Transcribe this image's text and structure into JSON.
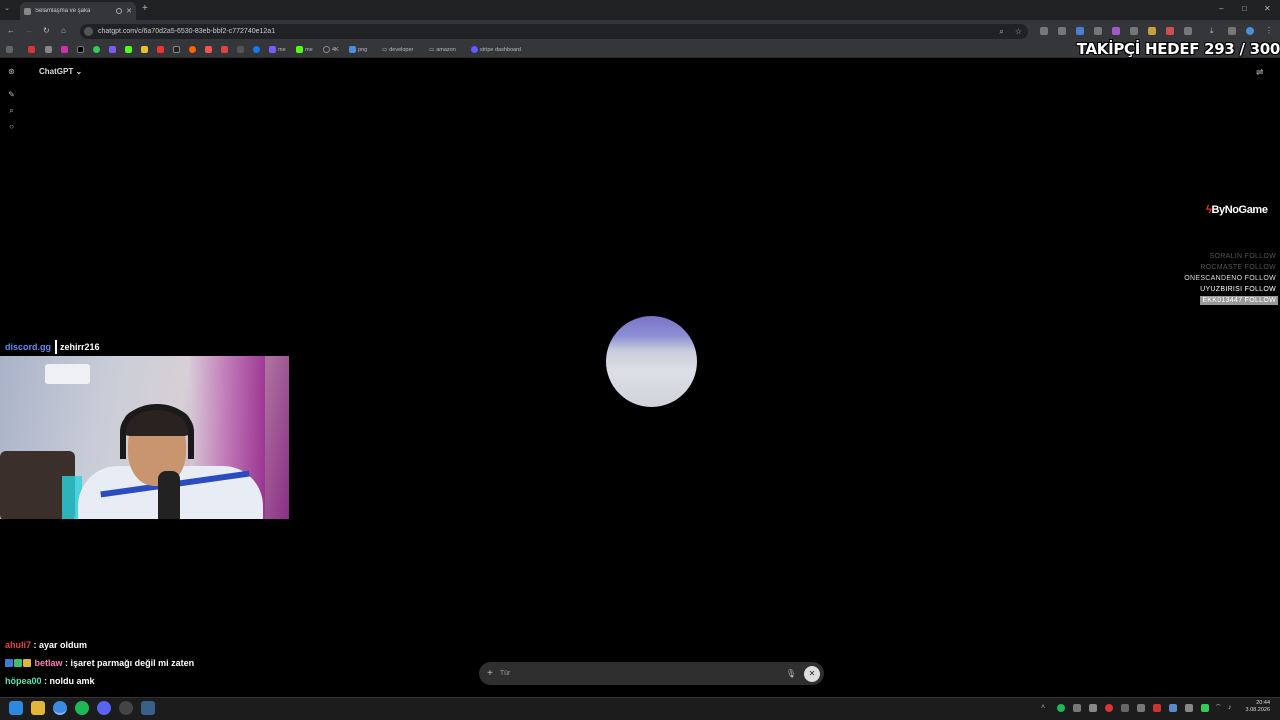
{
  "browser": {
    "tab_title": "Selamlaşma ve şaka",
    "url": "chatgpt.com/c/6a70d2a5-6530-83eb-bbf2-c772740e12a1",
    "bookmarks": [
      "me",
      "me",
      "4K",
      "png",
      "developer",
      "amazon",
      "stripe dashboard"
    ]
  },
  "overlay": {
    "goal_text": "TAKİPÇİ HEDEF 293 / 300",
    "brand": "ByNoGame",
    "follows": [
      {
        "text": "SORALIN  FOLLOW",
        "color": "#555555"
      },
      {
        "text": "ROCMASTE  FOLLOW",
        "color": "#555555"
      },
      {
        "text": "ONESCANDENO  FOLLOW",
        "color": "#dddddd"
      },
      {
        "text": "UYUZBIRISI  FOLLOW",
        "color": "#ffffff"
      },
      {
        "text": "EKK013447  FOLLOW",
        "color": "#ffffff",
        "highlight": true
      }
    ],
    "discord": "discord.gg",
    "handle": "zehirr216"
  },
  "chatgpt": {
    "model": "ChatGPT",
    "composer_placeholder": "Tür"
  },
  "chat": [
    {
      "user": "ahuli7",
      "user_color": "#e8424a",
      "message": ": ayar oldum",
      "badges": []
    },
    {
      "user": "betlaw",
      "user_color": "#ff7fb6",
      "message": ": işaret parmağı değil mi zaten",
      "badges": [
        "#3e7bd8",
        "#3fbf6a",
        "#e0b53a"
      ]
    },
    {
      "user": "höpea00",
      "user_color": "#58e6b0",
      "message": ": noldu amk",
      "badges": []
    }
  ],
  "taskbar": {
    "time": "20:44",
    "date": "3.08.2026"
  }
}
